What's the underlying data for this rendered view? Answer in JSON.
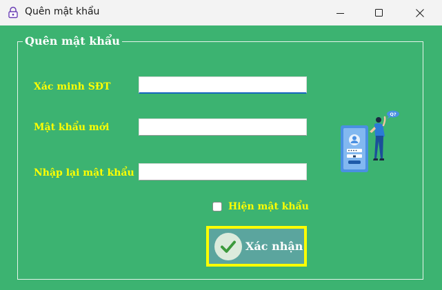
{
  "window": {
    "title": "Quên mật khẩu",
    "icons": [
      "app-lock-icon",
      "minimize-icon",
      "maximize-icon",
      "close-icon"
    ]
  },
  "form": {
    "group_title": "Quên mật khẩu",
    "phone_label": "Xác minh SĐT",
    "phone_value": "",
    "new_password_label": "Mật khẩu mới",
    "new_password_value": "",
    "confirm_password_label": "Nhập lại mật khẩu",
    "confirm_password_value": "",
    "show_password_label": "Hiện mật khẩu",
    "show_password_checked": false,
    "submit_label": "Xác nhận",
    "illustration_bubble_text": "Q?"
  },
  "colors": {
    "background": "#3cb371",
    "label_text": "#ffff00",
    "button_border": "#ffff00",
    "button_fill": "#5ba59e",
    "check_icon": "#3c9a3c",
    "focus_underline": "#1565c0"
  }
}
